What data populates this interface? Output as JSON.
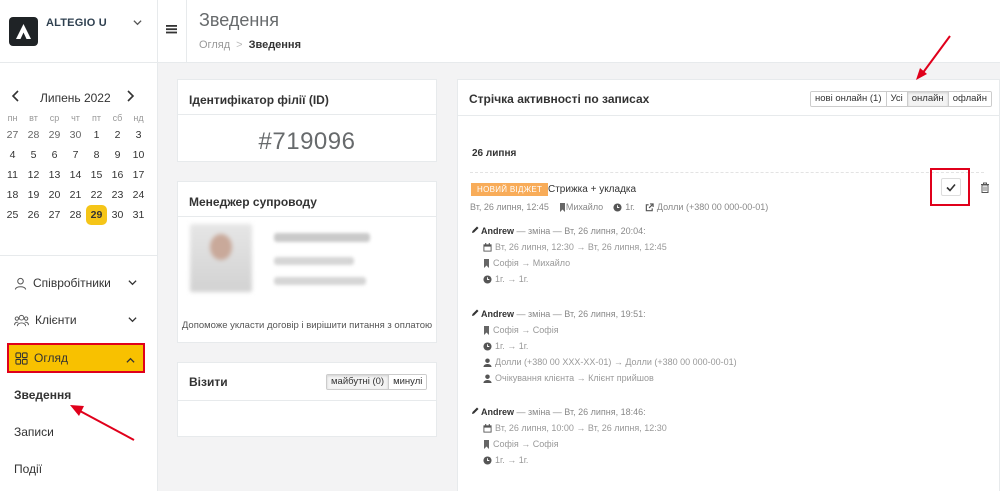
{
  "brand": {
    "name": "ALTEGIO U"
  },
  "calendar": {
    "month": "Липень 2022",
    "weekdays": [
      "пн",
      "вт",
      "ср",
      "чт",
      "пт",
      "сб",
      "нд"
    ],
    "days": [
      [
        "27",
        "28",
        "29",
        "30",
        "1",
        "2",
        "3"
      ],
      [
        "4",
        "5",
        "6",
        "7",
        "8",
        "9",
        "10"
      ],
      [
        "11",
        "12",
        "13",
        "14",
        "15",
        "16",
        "17"
      ],
      [
        "18",
        "19",
        "20",
        "21",
        "22",
        "23",
        "24"
      ],
      [
        "25",
        "26",
        "27",
        "28",
        "29",
        "30",
        "31"
      ]
    ],
    "selected": "29"
  },
  "nav": {
    "staff": "Співробітники",
    "clients": "Клієнти",
    "overview": "Огляд",
    "sub": [
      "Зведення",
      "Записи",
      "Події"
    ]
  },
  "header": {
    "title": "Зведення",
    "breadcrumb": [
      "Огляд",
      "Зведення"
    ]
  },
  "branch_id": {
    "title": "Ідентифікатор філії (ID)",
    "value": "#719096"
  },
  "manager": {
    "title": "Менеджер супроводу",
    "note": "Допоможе укласти договір і вирішити питання з оплатою"
  },
  "visits": {
    "title": "Візити",
    "tabs": [
      "майбутні (0)",
      "минулі"
    ]
  },
  "feed": {
    "title": "Стрічка активності по записах",
    "filters": [
      "нові онлайн (1)",
      "Усі",
      "онлайн",
      "офлайн"
    ],
    "active_filter": "онлайн",
    "date": "26 липня",
    "record": {
      "badge": "НОВИЙ ВІДЖЕТ",
      "service": "Стрижка + укладка",
      "datetime": "Вт, 26 липня, 12:45",
      "master": "Михайло",
      "duration": "1г.",
      "client": "Долли (+380 00 000-00-01)"
    },
    "changes": [
      {
        "author": "Andrew",
        "text": " — зміна — Вт, 26 липня, 20:04:",
        "lines": [
          "Вт, 26 липня, 12:30 → Вт, 26 липня, 12:45",
          "Софія → Михайло",
          "1г. → 1г."
        ]
      },
      {
        "author": "Andrew",
        "text": " — зміна — Вт, 26 липня, 19:51:",
        "lines": [
          "Софія → Софія",
          "1г. → 1г.",
          "Долли (+380 00 XXX-XX-01) → Долли (+380 00 000-00-01)",
          "Очікування клієнта → Клієнт прийшов"
        ]
      },
      {
        "author": "Andrew",
        "text": " — зміна — Вт, 26 липня, 18:46:",
        "lines": [
          "Вт, 26 липня, 10:00 → Вт, 26 липня, 12:30",
          "Софія → Софія",
          "1г. → 1г."
        ]
      }
    ]
  },
  "colors": {
    "accent": "#f8c100",
    "highlight_border": "#e0001b",
    "badge": "#f8ac59"
  }
}
